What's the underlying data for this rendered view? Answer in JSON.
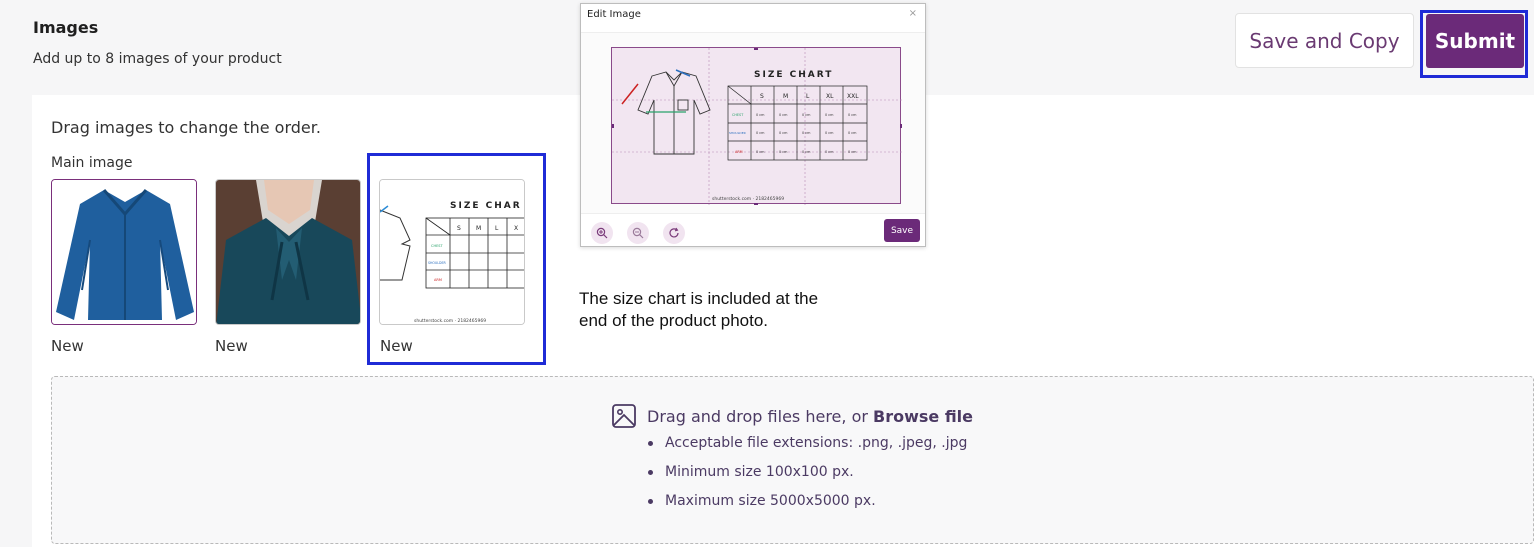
{
  "header": {
    "title": "Images",
    "subtitle": "Add up to 8 images of your product",
    "save_copy_label": "Save and Copy",
    "submit_label": "Submit"
  },
  "gallery": {
    "hint": "Drag images to change the order.",
    "main_label": "Main image",
    "items": [
      {
        "caption": "New"
      },
      {
        "caption": "New"
      },
      {
        "caption": "New"
      }
    ],
    "size_chart_thumb": {
      "title": "SIZE CHAR",
      "columns": [
        "S",
        "M",
        "L",
        "X"
      ],
      "rows": [
        "CHEST",
        "SHOULDER",
        "ARM"
      ],
      "credit": "shutterstock.com · 2182465969"
    }
  },
  "note": {
    "line1": "The size chart is included at the",
    "line2": "end of the product photo."
  },
  "dropzone": {
    "lead": "Drag and drop files here, or ",
    "browse": "Browse file",
    "rules": [
      "Acceptable file extensions: .png, .jpeg, .jpg",
      "Minimum size 100x100 px.",
      "Maximum size 5000x5000 px."
    ]
  },
  "modal": {
    "title": "Edit Image",
    "close": "×",
    "save_label": "Save",
    "chart": {
      "title": "SIZE CHART",
      "columns": [
        "S",
        "M",
        "L",
        "XL",
        "XXL"
      ],
      "rows": [
        "CHEST",
        "SHOULDER",
        "ARM"
      ],
      "cell": "0 cm",
      "credit": "shutterstock.com · 2182465969"
    },
    "tools": [
      "zoom-in-icon",
      "zoom-out-icon",
      "rotate-icon"
    ]
  },
  "colors": {
    "brand": "#6b2a79",
    "highlight": "#1f2bd6",
    "blouse": "#1f5f9e"
  }
}
